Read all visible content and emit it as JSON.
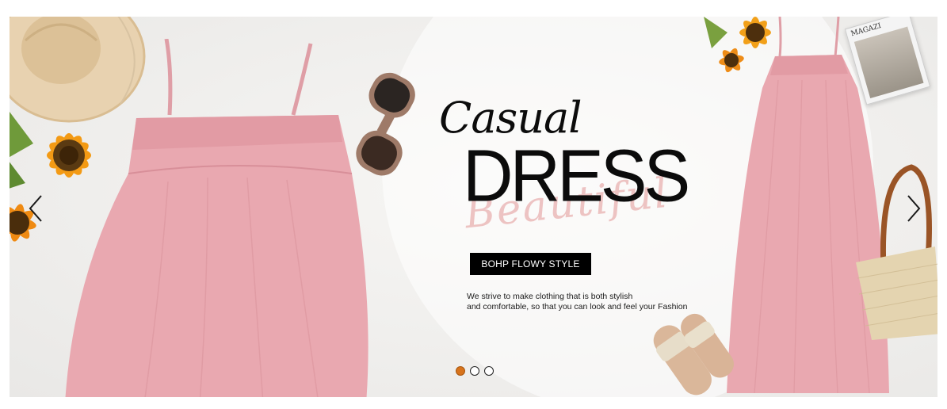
{
  "hero": {
    "title_script": "Casual",
    "title_main": "DRESS",
    "title_overlay": "Beautiful",
    "cta_label": "BOHP FLOWY STYLE",
    "description_line1": "We strive to make clothing that is both stylish",
    "description_line2": "and comfortable, so that you can look and feel your Fashion",
    "magazine_label": "MAGAZI",
    "slides_total": 3,
    "active_slide": 1
  },
  "colors": {
    "dress_pink": "#e9a8b0",
    "dot_active": "#d7731c",
    "cta_bg": "#000000"
  },
  "icons": {
    "prev": "chevron-left-icon",
    "next": "chevron-right-icon"
  }
}
